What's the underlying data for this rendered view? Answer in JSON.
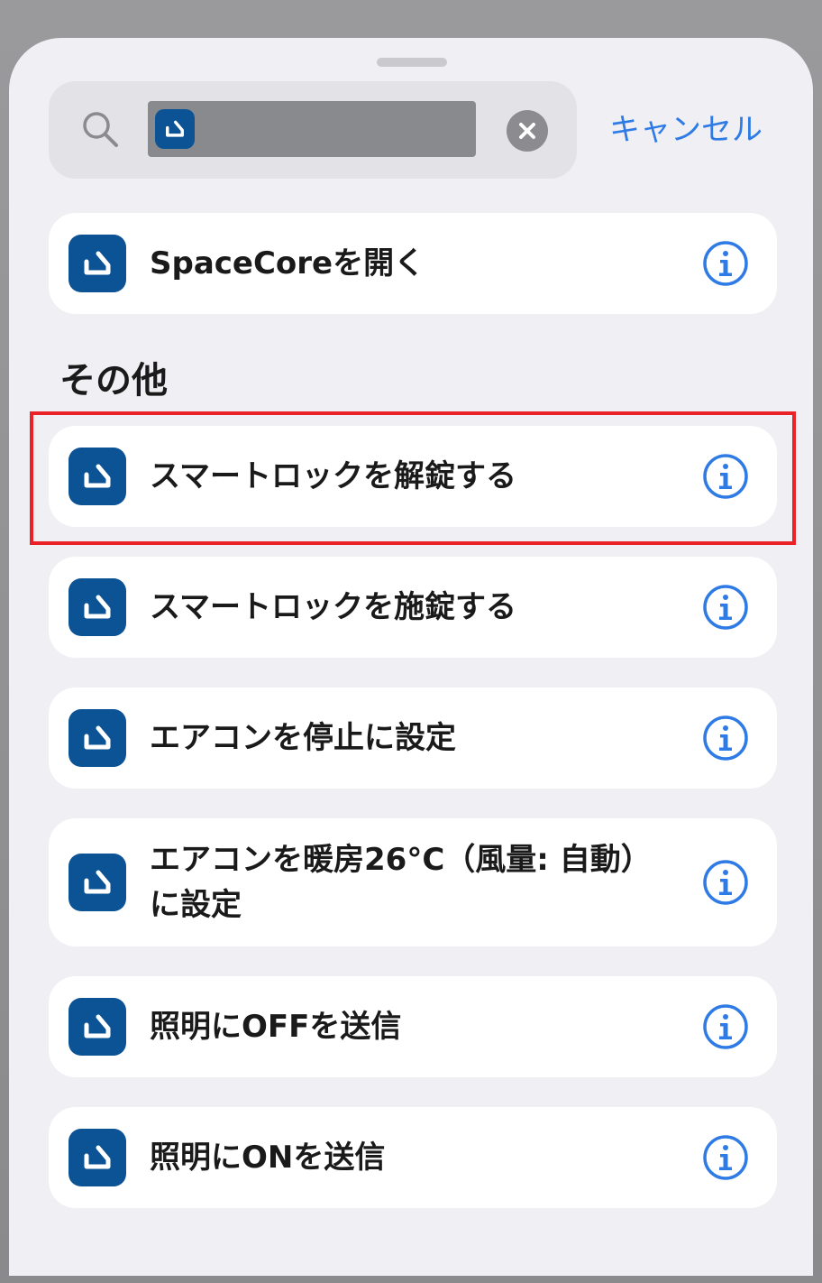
{
  "search": {
    "cancel_label": "キャンセル"
  },
  "top_action": {
    "label": "SpaceCoreを開く",
    "icon": "spacecore-app-icon"
  },
  "section": {
    "title": "その他"
  },
  "actions": [
    {
      "label": "スマートロックを解錠する",
      "highlighted": true
    },
    {
      "label": "スマートロックを施錠する"
    },
    {
      "label": "エアコンを停止に設定"
    },
    {
      "label": "エアコンを暖房26°C（風量: 自動）に設定"
    },
    {
      "label": "照明にOFFを送信"
    },
    {
      "label": "照明にONを送信"
    }
  ],
  "colors": {
    "accent": "#2f7be5",
    "app_icon": "#0b5394",
    "highlight": "#ea2227"
  }
}
